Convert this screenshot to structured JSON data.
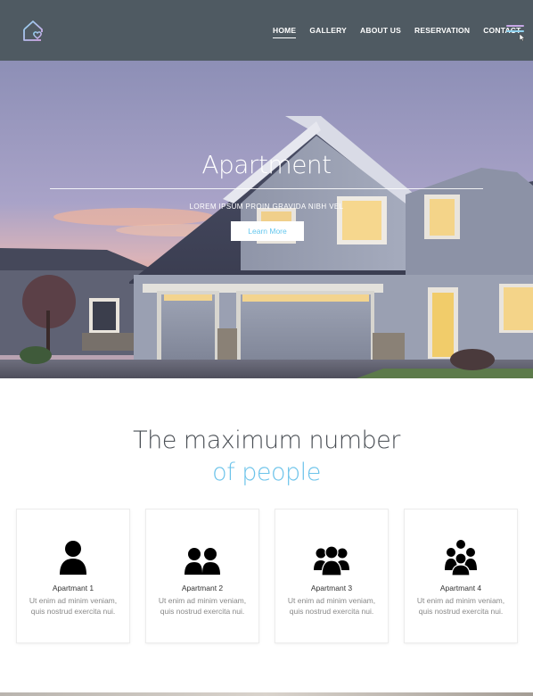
{
  "header": {
    "logo_icon": "house-heart-icon",
    "nav": [
      {
        "label": "HOME",
        "active": true
      },
      {
        "label": "GALLERY",
        "active": false
      },
      {
        "label": "ABOUT US",
        "active": false
      },
      {
        "label": "RESERVATION",
        "active": false
      },
      {
        "label": "CONTACT",
        "active": false
      }
    ],
    "menu_icon": "hamburger-menu-icon"
  },
  "hero": {
    "title": "Apartment",
    "subtitle": "LOREM IPSUM PROIN GRAVIDA NIBH VEL",
    "button_label": "Learn More"
  },
  "section": {
    "title_line1": "The maximum number",
    "title_line2": "of people",
    "accent_color": "#6cc3ea"
  },
  "cards": [
    {
      "title": "Apartmant 1",
      "text": "Ut enim ad minim  veniam, quis nostrud exercita nui.",
      "icon": "person-icon"
    },
    {
      "title": "Apartmant 2",
      "text": "Ut enim ad minim  veniam, quis nostrud exercita nui.",
      "icon": "two-people-icon"
    },
    {
      "title": "Apartmant 3",
      "text": "Ut enim ad minim  veniam, quis nostrud exercita nui.",
      "icon": "three-people-icon"
    },
    {
      "title": "Apartmant 4",
      "text": "Ut enim ad minim  veniam, quis nostrud exercita nui.",
      "icon": "four-people-icon"
    }
  ],
  "colors": {
    "header_bg": "#4f5a62",
    "accent": "#6cc3ea"
  }
}
